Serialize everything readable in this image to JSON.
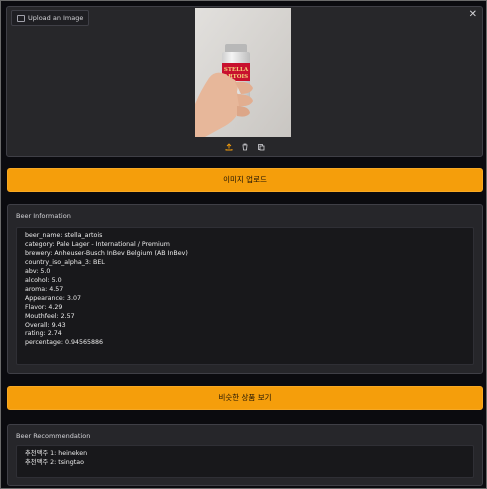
{
  "upload": {
    "label": "Upload an Image",
    "close_glyph": "✕"
  },
  "upload_button": {
    "label": "이미지 업로드"
  },
  "beer_info": {
    "title": "Beer Information",
    "lines": [
      "beer_name: stella_artois",
      "category: Pale Lager - International / Premium",
      "brewery: Anheuser-Busch InBev Belgium (AB InBev)",
      "country_iso_alpha_3: BEL",
      "abv: 5.0",
      "alcohol: 5.0",
      "aroma: 4.57",
      "Appearance: 3.07",
      "Flavor: 4.29",
      "Mouthfeel: 2.57",
      "Overall: 9.43",
      "rating: 2.74",
      "percentage: 0.94565886"
    ]
  },
  "similar_button": {
    "label": "비슷한 상품 보기"
  },
  "recommendation": {
    "title": "Beer Recommendation",
    "lines": [
      "추천맥주 1: heineken",
      "추천맥주 2: tsingtao"
    ]
  },
  "photo_can_text": [
    "STELLA",
    "ARTOIS"
  ],
  "colors": {
    "accent": "#f59e0b",
    "panel": "#26262a",
    "background": "#0b0b0f"
  },
  "icons": [
    "image-icon",
    "close-icon",
    "upload-icon",
    "trash-icon",
    "clipboard-icon"
  ]
}
